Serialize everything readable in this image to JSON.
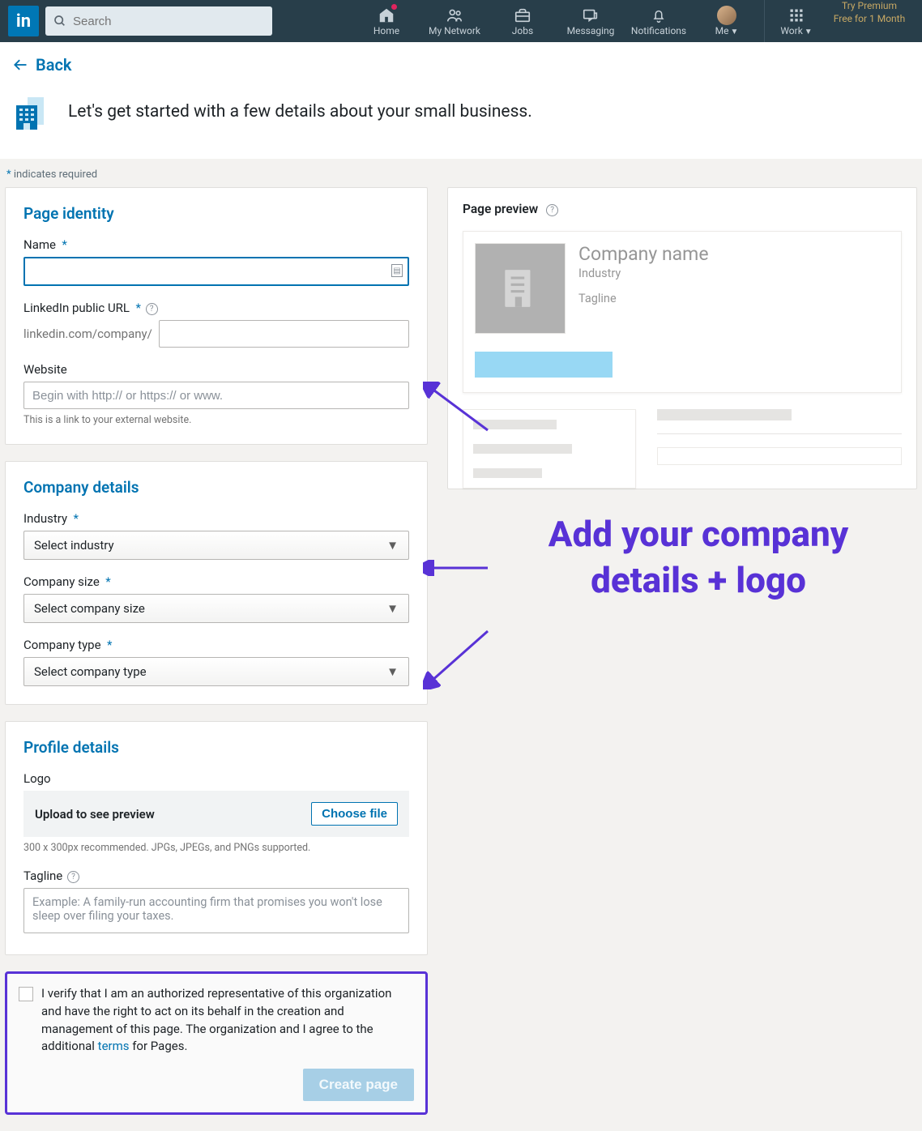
{
  "nav": {
    "search_placeholder": "Search",
    "home": "Home",
    "network": "My Network",
    "jobs": "Jobs",
    "messaging": "Messaging",
    "notifications": "Notifications",
    "me": "Me",
    "work": "Work",
    "premium_l1": "Try Premium",
    "premium_l2": "Free for 1 Month"
  },
  "back_label": "Back",
  "intro": "Let's get started with a few details about your small business.",
  "required_note": "indicates required",
  "identity": {
    "heading": "Page identity",
    "name_label": "Name",
    "url_label": "LinkedIn public URL",
    "url_prefix": "linkedin.com/company/",
    "website_label": "Website",
    "website_placeholder": "Begin with http:// or https:// or www.",
    "website_hint": "This is a link to your external website."
  },
  "company": {
    "heading": "Company details",
    "industry_label": "Industry",
    "industry_value": "Select industry",
    "size_label": "Company size",
    "size_value": "Select company size",
    "type_label": "Company type",
    "type_value": "Select company type"
  },
  "profile": {
    "heading": "Profile details",
    "logo_label": "Logo",
    "upload_text": "Upload to see preview",
    "choose_file": "Choose file",
    "logo_hint": "300 x 300px recommended. JPGs, JPEGs, and PNGs supported.",
    "tagline_label": "Tagline",
    "tagline_placeholder": "Example: A family-run accounting firm that promises you won't lose sleep over filing your taxes."
  },
  "verify": {
    "text_before": "I verify that I am an authorized representative of this organization and have the right to act on its behalf in the creation and management of this page. The organization and I agree to the additional ",
    "terms": "terms",
    "text_after": " for Pages.",
    "create_label": "Create page"
  },
  "preview": {
    "title": "Page preview",
    "company": "Company name",
    "industry": "Industry",
    "tagline": "Tagline"
  },
  "annotation": "Add your company details + logo"
}
